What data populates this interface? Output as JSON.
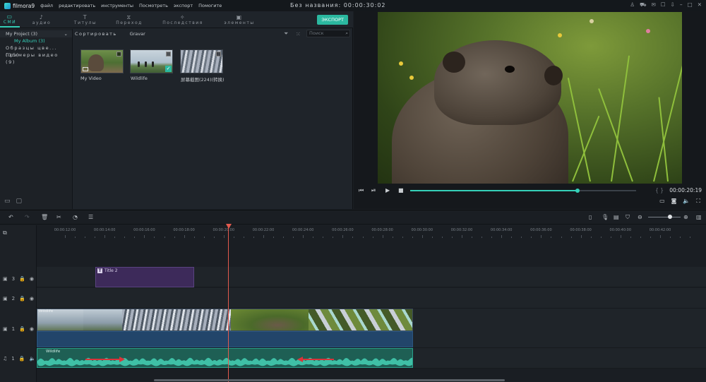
{
  "app": {
    "logo_text": "filmora9",
    "menu": [
      "файл",
      "редактировать",
      "инструменты",
      "Посмотреть",
      "экспорт",
      "Помогите"
    ],
    "project_title": "Без названия: 00:00:30:02"
  },
  "tabs": [
    {
      "label": "СМИ",
      "icon": "folder-icon"
    },
    {
      "label": "аудио",
      "icon": "music-note-icon"
    },
    {
      "label": "Титулы",
      "icon": "text-icon"
    },
    {
      "label": "Переход",
      "icon": "transition-icon"
    },
    {
      "label": "Последствия",
      "icon": "effects-icon"
    },
    {
      "label": "элементы",
      "icon": "image-icon"
    }
  ],
  "export_label": "ЭКСПОРТ",
  "sidebar": {
    "items": [
      {
        "label": "My Project",
        "count": "(3)"
      },
      {
        "label": "My Album",
        "count": "(3)"
      },
      {
        "label": "Образцы цве...",
        "count": "(15)"
      },
      {
        "label": "Примеры видео",
        "count": "(9)"
      }
    ]
  },
  "media_toolbar": {
    "sort_label": "Сортировать",
    "gravar_label": "Gravar",
    "search_placeholder": "Поиск"
  },
  "media_items": [
    {
      "name": "My Video"
    },
    {
      "name": "Wildlife"
    },
    {
      "name": "屏幕截图(224)(转换)"
    }
  ],
  "player": {
    "timecode": "00:00:20:19",
    "brackets": "{ }",
    "progress_fraction": 0.74
  },
  "timeline": {
    "ticks": [
      "00:00:12:00",
      "00:00:14:00",
      "00:00:16:00",
      "00:00:18:00",
      "00:00:20:00",
      "00:00:22:00",
      "00:00:24:00",
      "00:00:26:00",
      "00:00:28:00",
      "00:00:30:00",
      "00:00:32:00",
      "00:00:34:00",
      "00:00:36:00",
      "00:00:38:00",
      "00:00:40:00",
      "00:00:42:00"
    ],
    "tracks": [
      {
        "label": "3"
      },
      {
        "label": "2"
      },
      {
        "label": "1"
      },
      {
        "label": "1"
      }
    ],
    "title_clip_label": "Title 2",
    "video_clip_label": "Wildlife",
    "audio_clip_label": "Wildlife"
  }
}
